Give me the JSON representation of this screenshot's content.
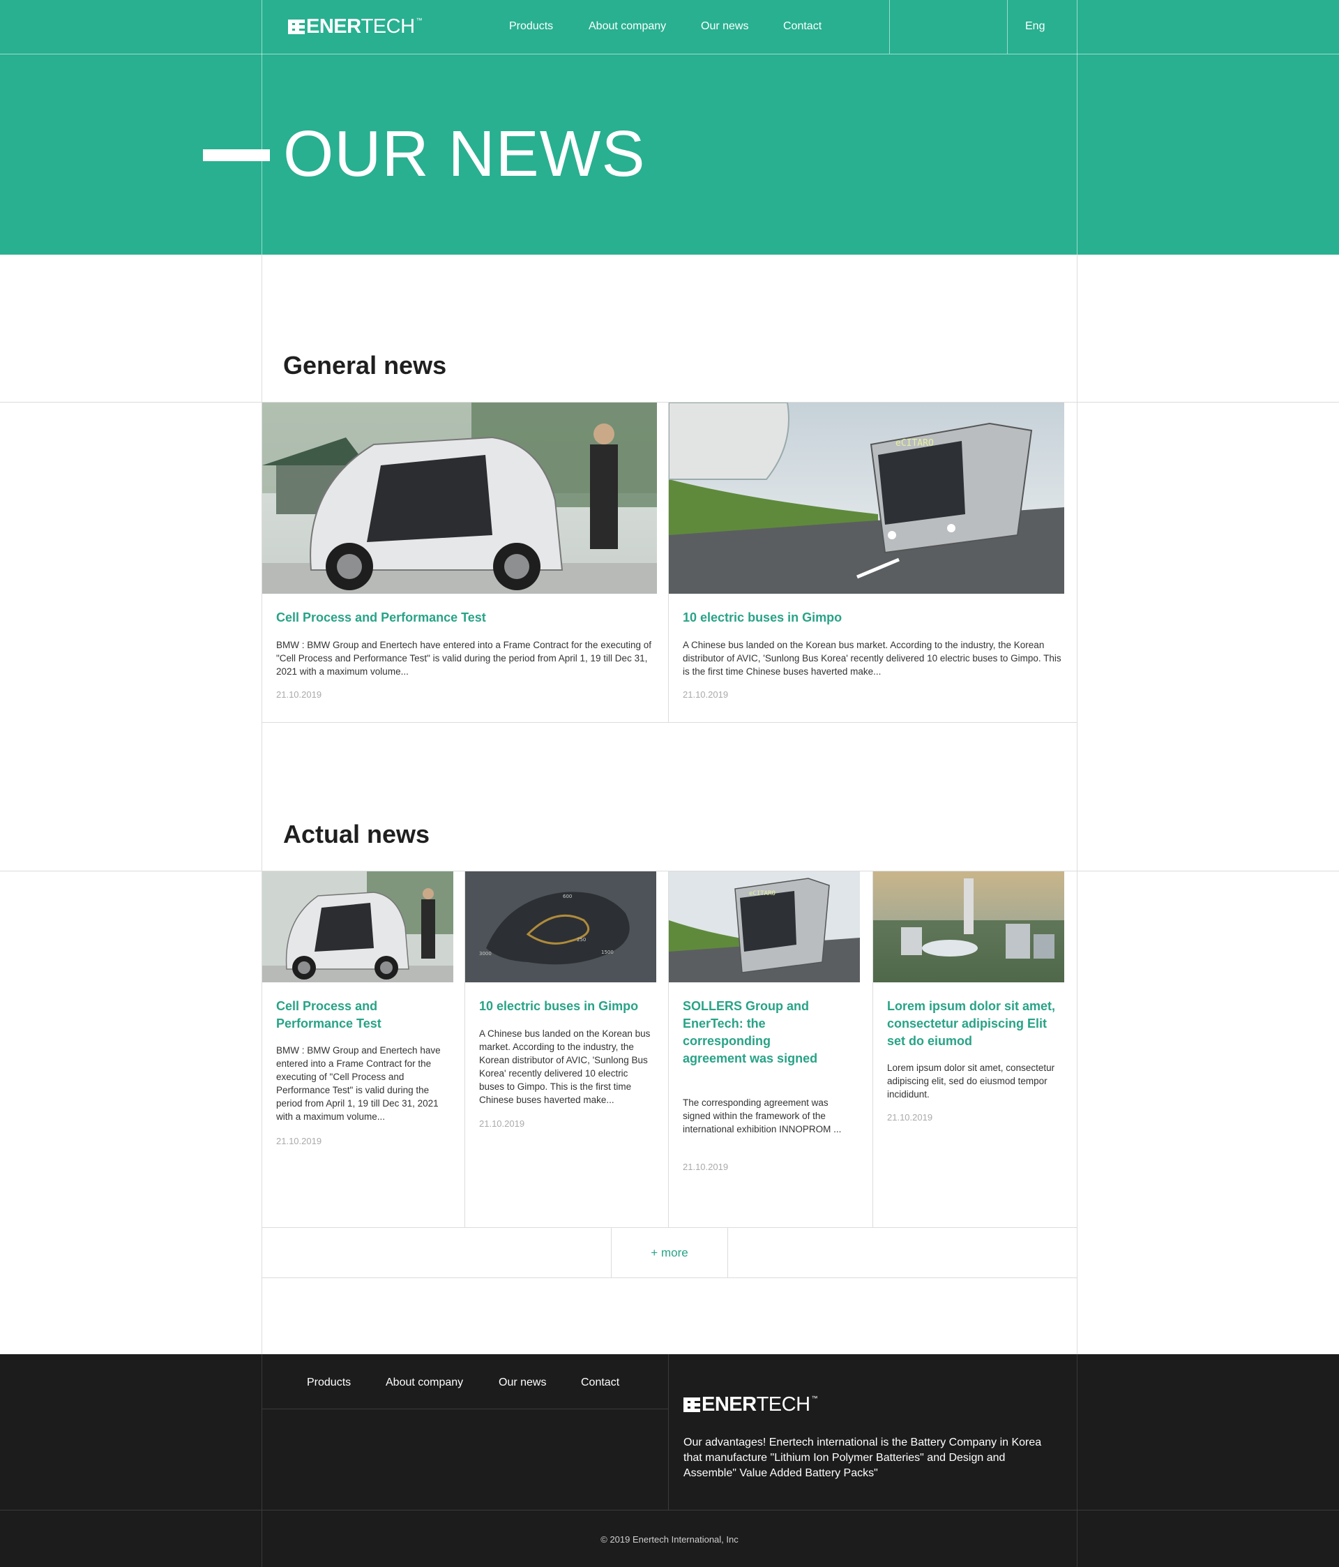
{
  "header": {
    "logo_bold": "ENER",
    "logo_light": "TECH",
    "logo_tm": "™",
    "nav": [
      "Products",
      "About company",
      "Our news",
      "Contact"
    ],
    "lang": "Eng"
  },
  "hero": {
    "title": "OUR NEWS"
  },
  "general": {
    "title": "General news",
    "cards": [
      {
        "title": "Cell Process and Performance Test",
        "text": "BMW : BMW Group and Enertech have entered into a Frame Contract for the executing of \"Cell Process and Performance Test\" is valid during the period from April 1, 19 till Dec 31, 2021 with a maximum volume...",
        "date": "21.10.2019"
      },
      {
        "title": "10 electric buses in Gimpo",
        "text": "A Chinese bus landed on the Korean bus market. According to the industry, the Korean distributor of AVIC, 'Sunlong Bus Korea' recently delivered 10 electric buses to Gimpo. This is the first time Chinese buses haverted make...",
        "date": "21.10.2019"
      }
    ]
  },
  "actual": {
    "title": "Actual news",
    "cards": [
      {
        "title": "Cell Process and Performance Test",
        "text": "BMW : BMW Group and Enertech have entered into a Frame Contract for the executing of \"Cell Process and Performance Test\" is valid during the period from April 1, 19 till Dec 31, 2021 with a maximum volume...",
        "date": "21.10.2019"
      },
      {
        "title": "10 electric buses in Gimpo",
        "text": "A Chinese bus landed on the Korean bus market. According to the industry, the Korean distributor of AVIC, 'Sunlong Bus Korea' recently delivered 10 electric buses to Gimpo. This is the first time Chinese buses haverted make...",
        "date": "21.10.2019"
      },
      {
        "title": "SOLLERS Group and EnerTech: the corresponding agreement was signed",
        "text": "The corresponding agreement was signed within the framework of the international exhibition INNOPROM ...",
        "date": "21.10.2019"
      },
      {
        "title": "Lorem ipsum dolor sit amet, consectetur adipiscing Elit set do eiumod",
        "text": "Lorem ipsum dolor sit amet, consectetur adipiscing elit, sed do eiusmod tempor incididunt.",
        "date": "21.10.2019"
      }
    ],
    "more_label": "+ more"
  },
  "footer": {
    "nav": [
      "Products",
      "About company",
      "Our news",
      "Contact"
    ],
    "logo_bold": "ENER",
    "logo_light": "TECH",
    "logo_tm": "™",
    "description": "Our advantages! Enertech international is the Battery Company in Korea that manufacture \"Lithium Ion Polymer Batteries\" and Design and Assemble\" Value Added Battery Packs\"",
    "copyright": "© 2019 Enertech International, Inc"
  },
  "colors": {
    "brand": "#28b090",
    "link": "#28a387",
    "footer_bg": "#1c1c1c"
  },
  "image_labels": {
    "bus_sign": "eCITARO",
    "map_labels": [
      "600",
      "3000",
      "1500",
      "250"
    ]
  }
}
